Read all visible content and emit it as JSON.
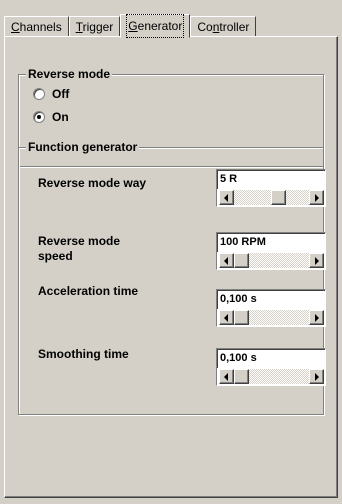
{
  "tabs": [
    {
      "label_pre": "",
      "label_u": "C",
      "label_post": "hannels",
      "active": false
    },
    {
      "label_pre": "",
      "label_u": "T",
      "label_post": "rigger",
      "active": false
    },
    {
      "label_pre": "",
      "label_u": "G",
      "label_post": "enerator",
      "active": true
    },
    {
      "label_pre": "Co",
      "label_u": "n",
      "label_post": "troller",
      "active": false
    }
  ],
  "reverse_mode": {
    "title": "Reverse mode",
    "options": [
      {
        "label": "Off",
        "selected": false
      },
      {
        "label": "On",
        "selected": true
      }
    ]
  },
  "function_generator": {
    "title": "Function generator",
    "params": [
      {
        "label": "Reverse mode way",
        "value": "5 R",
        "slider_fraction": 0.62
      },
      {
        "label": "Reverse mode\nspeed",
        "value": "100 RPM",
        "slider_fraction": 0.0
      },
      {
        "label": "Acceleration time",
        "value": "0,100 s",
        "slider_fraction": 0.0
      },
      {
        "label": "Smoothing time",
        "value": "0,100 s",
        "slider_fraction": 0.0
      }
    ]
  },
  "colors": {
    "face": "#d4d0c8",
    "shadow": "#808080",
    "highlight": "#ffffff"
  },
  "icons": [
    "scroll-left-arrow-icon",
    "scroll-right-arrow-icon"
  ]
}
